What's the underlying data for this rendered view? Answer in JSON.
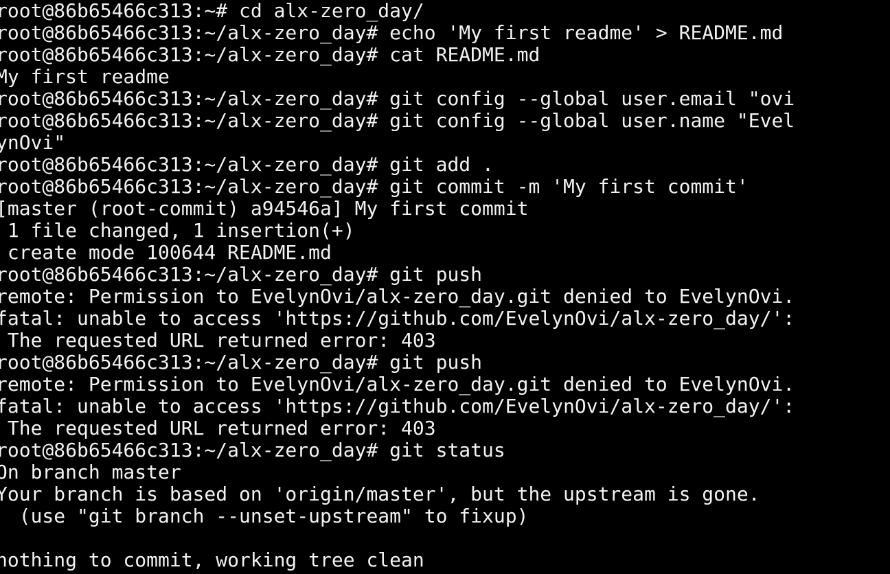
{
  "terminal": {
    "background": "#000000",
    "foreground": "#f2f2f2",
    "lines": [
      "root@86b65466c313:~# cd alx-zero_day/",
      "root@86b65466c313:~/alx-zero_day# echo 'My first readme' > README.md",
      "root@86b65466c313:~/alx-zero_day# cat README.md",
      "My first readme",
      "root@86b65466c313:~/alx-zero_day# git config --global user.email \"ovi",
      "root@86b65466c313:~/alx-zero_day# git config --global user.name \"Evel",
      "ynOvi\"",
      "root@86b65466c313:~/alx-zero_day# git add .",
      "root@86b65466c313:~/alx-zero_day# git commit -m 'My first commit'",
      "[master (root-commit) a94546a] My first commit",
      " 1 file changed, 1 insertion(+)",
      " create mode 100644 README.md",
      "root@86b65466c313:~/alx-zero_day# git push",
      "remote: Permission to EvelynOvi/alx-zero_day.git denied to EvelynOvi.",
      "fatal: unable to access 'https://github.com/EvelynOvi/alx-zero_day/':",
      " The requested URL returned error: 403",
      "root@86b65466c313:~/alx-zero_day# git push",
      "remote: Permission to EvelynOvi/alx-zero_day.git denied to EvelynOvi.",
      "fatal: unable to access 'https://github.com/EvelynOvi/alx-zero_day/':",
      " The requested URL returned error: 403",
      "root@86b65466c313:~/alx-zero_day# git status",
      "On branch master",
      "Your branch is based on 'origin/master', but the upstream is gone.",
      "  (use \"git branch --unset-upstream\" to fixup)",
      "",
      "nothing to commit, working tree clean"
    ]
  }
}
